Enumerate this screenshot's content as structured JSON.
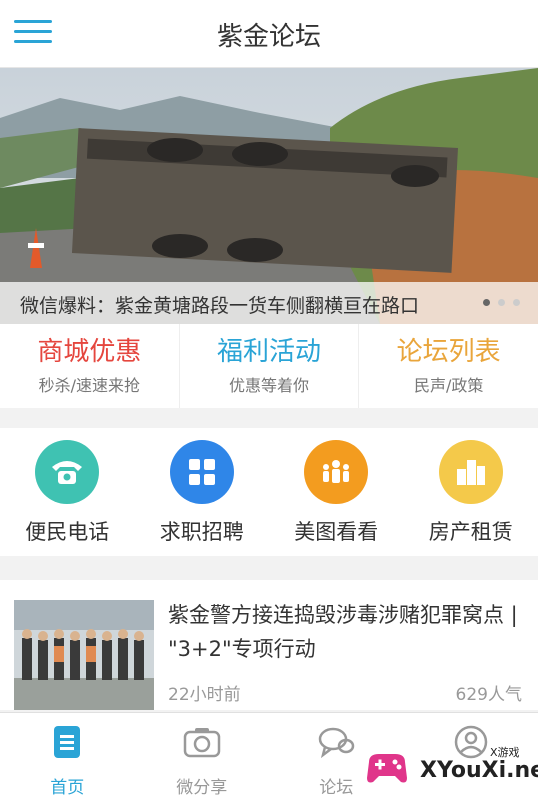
{
  "header": {
    "title": "紫金论坛",
    "menu_icon": "hamburger-menu-icon"
  },
  "banner": {
    "caption": "微信爆料：紫金黄塘路段一货车侧翻横亘在路口",
    "slide_count": 3,
    "active_slide": 0
  },
  "promo": [
    {
      "title": "商城优惠",
      "subtitle": "秒杀/速速来抢",
      "color": "#e5463e"
    },
    {
      "title": "福利活动",
      "subtitle": "优惠等着你",
      "color": "#2aa4d6"
    },
    {
      "title": "论坛列表",
      "subtitle": "民声/政策",
      "color": "#e9a53b"
    }
  ],
  "services": [
    {
      "label": "便民电话",
      "icon": "telephone-icon",
      "color": "#3fc2b2"
    },
    {
      "label": "求职招聘",
      "icon": "grid-icon",
      "color": "#2f86e8"
    },
    {
      "label": "美图看看",
      "icon": "people-icon",
      "color": "#f39c1f"
    },
    {
      "label": "房产租赁",
      "icon": "buildings-icon",
      "color": "#f4c94a"
    }
  ],
  "news": {
    "title": "紫金警方接连捣毁涉毒涉赌犯罪窝点 | \"3+2\"专项行动",
    "time": "22小时前",
    "views": "629人气"
  },
  "tabbar": [
    {
      "label": "首页",
      "icon": "home-doc-icon",
      "active": true
    },
    {
      "label": "微分享",
      "icon": "camera-icon",
      "active": false
    },
    {
      "label": "论坛",
      "icon": "chat-icon",
      "active": false
    },
    {
      "label": "",
      "icon": "profile-icon",
      "active": false
    }
  ],
  "watermark": {
    "brand": "XYouXi.net",
    "tag": "X游戏"
  },
  "colors": {
    "accent": "#2aa4d6",
    "background": "#f2f2f2"
  }
}
